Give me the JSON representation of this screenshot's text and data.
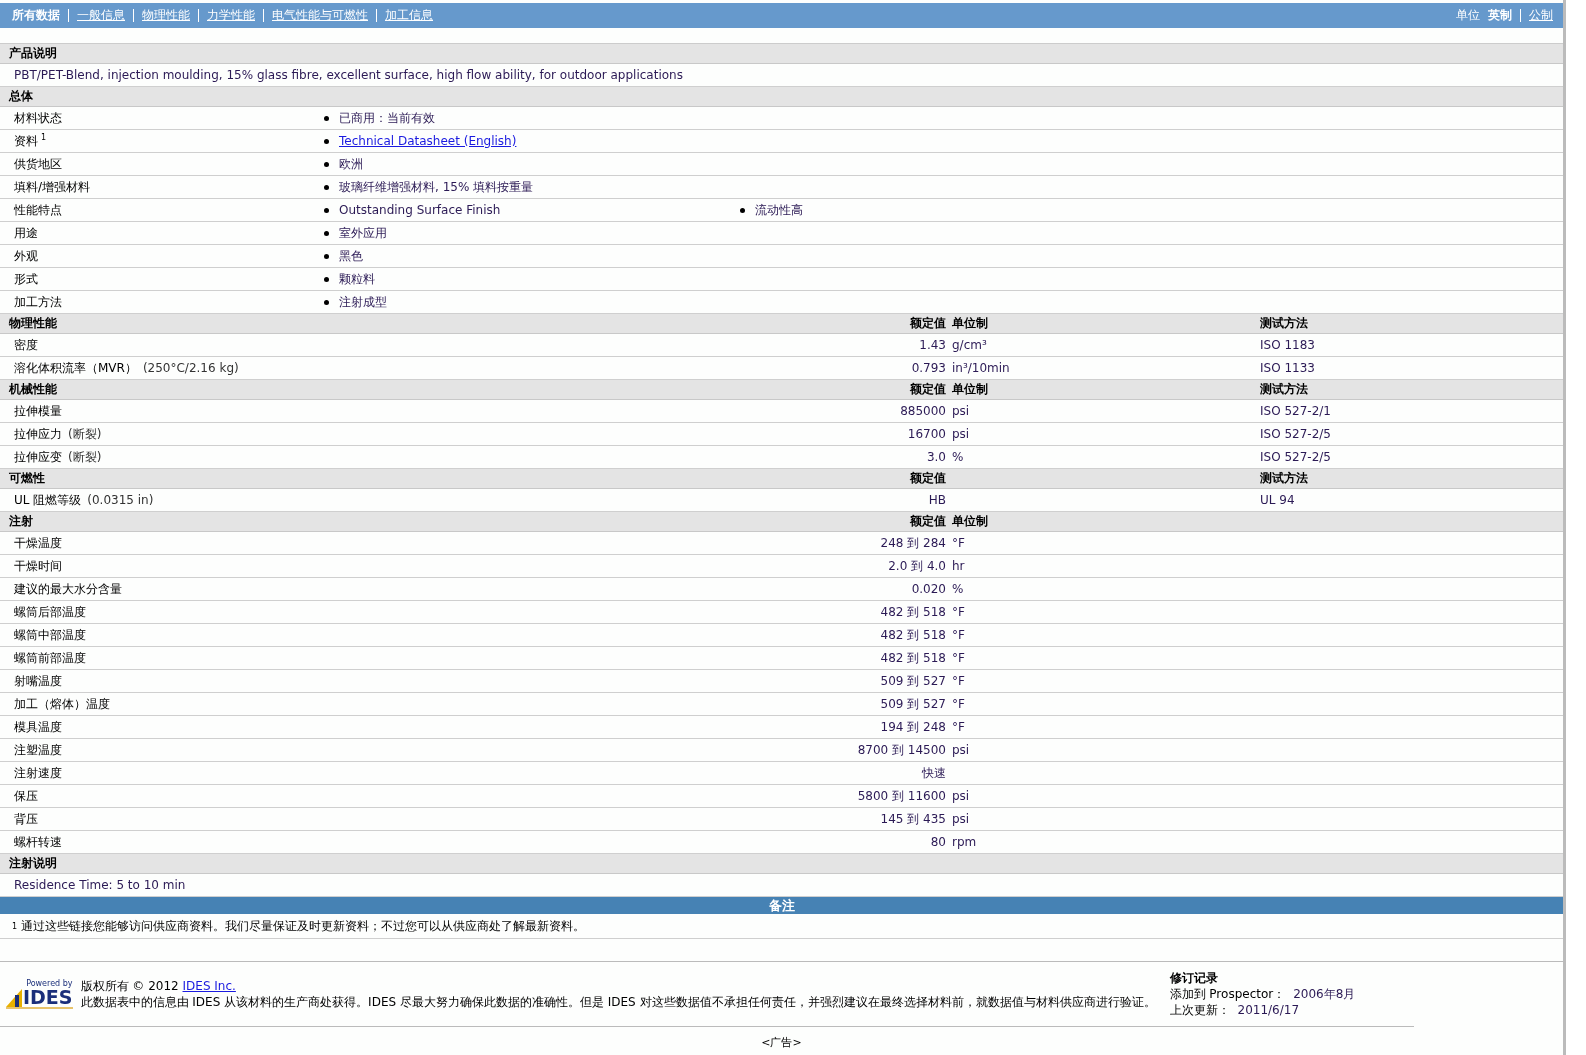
{
  "nav": {
    "tabs": [
      {
        "label": "所有数据",
        "selected": true
      },
      {
        "label": "一般信息",
        "selected": false
      },
      {
        "label": "物理性能",
        "selected": false
      },
      {
        "label": "力学性能",
        "selected": false
      },
      {
        "label": "电气性能与可燃性",
        "selected": false
      },
      {
        "label": "加工信息",
        "selected": false
      }
    ],
    "units_label": "单位",
    "units": [
      {
        "label": "英制",
        "selected": true
      },
      {
        "label": "公制",
        "selected": false
      }
    ]
  },
  "sections": [
    {
      "kind": "text",
      "title": "产品说明",
      "text": "PBT/PET-Blend, injection moulding, 15% glass fibre, excellent surface, high flow ability, for outdoor applications"
    },
    {
      "kind": "general",
      "title": "总体",
      "rows": [
        {
          "label": "材料状态",
          "items": [
            {
              "text": "已商用：当前有效",
              "link": false
            }
          ]
        },
        {
          "label": "资料",
          "note": "1",
          "items": [
            {
              "text": "Technical Datasheet (English)",
              "link": true
            }
          ]
        },
        {
          "label": "供货地区",
          "items": [
            {
              "text": "欧洲",
              "link": false
            }
          ]
        },
        {
          "label": "填料/增强材料",
          "items": [
            {
              "text": "玻璃纤维增强材料, 15% 填料按重量",
              "link": false
            }
          ]
        },
        {
          "label": "性能特点",
          "items": [
            {
              "text": "Outstanding Surface Finish",
              "link": false
            },
            {
              "text": "流动性高",
              "link": false
            }
          ]
        },
        {
          "label": "用途",
          "items": [
            {
              "text": "室外应用",
              "link": false
            }
          ]
        },
        {
          "label": "外观",
          "items": [
            {
              "text": "黑色",
              "link": false
            }
          ]
        },
        {
          "label": "形式",
          "items": [
            {
              "text": "颗粒料",
              "link": false
            }
          ]
        },
        {
          "label": "加工方法",
          "items": [
            {
              "text": "注射成型",
              "link": false
            }
          ]
        }
      ]
    },
    {
      "kind": "properties",
      "title": "物理性能",
      "headers": {
        "value": "额定值",
        "unit": "单位制",
        "method": "测试方法"
      },
      "rows": [
        {
          "label": "密度",
          "value": "1.43",
          "unit": "g/cm³",
          "method": "ISO 1183"
        },
        {
          "label": "溶化体积流率（MVR）",
          "condition": "(250°C/2.16 kg)",
          "value": "0.793",
          "unit": "in³/10min",
          "method": "ISO 1133"
        }
      ]
    },
    {
      "kind": "properties",
      "title": "机械性能",
      "headers": {
        "value": "额定值",
        "unit": "单位制",
        "method": "测试方法"
      },
      "rows": [
        {
          "label": "拉伸模量",
          "value": "885000",
          "unit": "psi",
          "method": "ISO 527-2/1"
        },
        {
          "label": "拉伸应力",
          "condition": "(断裂)",
          "value": "16700",
          "unit": "psi",
          "method": "ISO 527-2/5"
        },
        {
          "label": "拉伸应变",
          "condition": "(断裂)",
          "value": "3.0",
          "unit": "%",
          "method": "ISO 527-2/5"
        }
      ]
    },
    {
      "kind": "properties",
      "title": "可燃性",
      "headers": {
        "value": "额定值",
        "method": "测试方法"
      },
      "rows": [
        {
          "label": "UL 阻燃等级",
          "condition": "(0.0315 in)",
          "value": "HB",
          "method": "UL 94"
        }
      ]
    },
    {
      "kind": "properties",
      "title": "注射",
      "headers": {
        "value": "额定值",
        "unit": "单位制"
      },
      "rows": [
        {
          "label": "干燥温度",
          "value": "248 到 284",
          "unit": "°F"
        },
        {
          "label": "干燥时间",
          "value": "2.0 到 4.0",
          "unit": "hr"
        },
        {
          "label": "建议的最大水分含量",
          "value": "0.020",
          "unit": "%"
        },
        {
          "label": "螺筒后部温度",
          "value": "482 到 518",
          "unit": "°F"
        },
        {
          "label": "螺筒中部温度",
          "value": "482 到 518",
          "unit": "°F"
        },
        {
          "label": "螺筒前部温度",
          "value": "482 到 518",
          "unit": "°F"
        },
        {
          "label": "射嘴温度",
          "value": "509 到 527",
          "unit": "°F"
        },
        {
          "label": "加工（熔体）温度",
          "value": "509 到 527",
          "unit": "°F"
        },
        {
          "label": "模具温度",
          "value": "194 到 248",
          "unit": "°F"
        },
        {
          "label": "注塑温度",
          "value": "8700 到 14500",
          "unit": "psi"
        },
        {
          "label": "注射速度",
          "value": "快速"
        },
        {
          "label": "保压",
          "value": "5800 到 11600",
          "unit": "psi"
        },
        {
          "label": "背压",
          "value": "145 到 435",
          "unit": "psi"
        },
        {
          "label": "螺杆转速",
          "value": "80",
          "unit": "rpm"
        }
      ]
    },
    {
      "kind": "text",
      "title": "注射说明",
      "text": "Residence Time: 5 to 10 min"
    }
  ],
  "notes": {
    "title": "备注",
    "items": [
      {
        "mark": "1",
        "text": "通过这些链接您能够访问供应商资料。我们尽量保证及时更新资料；不过您可以从供应商处了解最新资料。"
      }
    ]
  },
  "footer": {
    "logo": {
      "top": "Powered by",
      "name": "IDES"
    },
    "copyright": "版权所有 © 2012",
    "company_link": "IDES Inc.",
    "disclaimer": "此数据表中的信息由 IDES 从该材料的生产商处获得。IDES 尽最大努力确保此数据的准确性。但是 IDES 对这些数据值不承担任何责任，并强烈建议在最终选择材料前，就数据值与材料供应商进行验证。",
    "revision": {
      "title": "修订记录",
      "rows": [
        {
          "label": "添加到 Prospector：",
          "value": "2006年8月"
        },
        {
          "label": "上次更新：",
          "value": "2011/6/17"
        }
      ]
    }
  },
  "ad": "<广告>"
}
